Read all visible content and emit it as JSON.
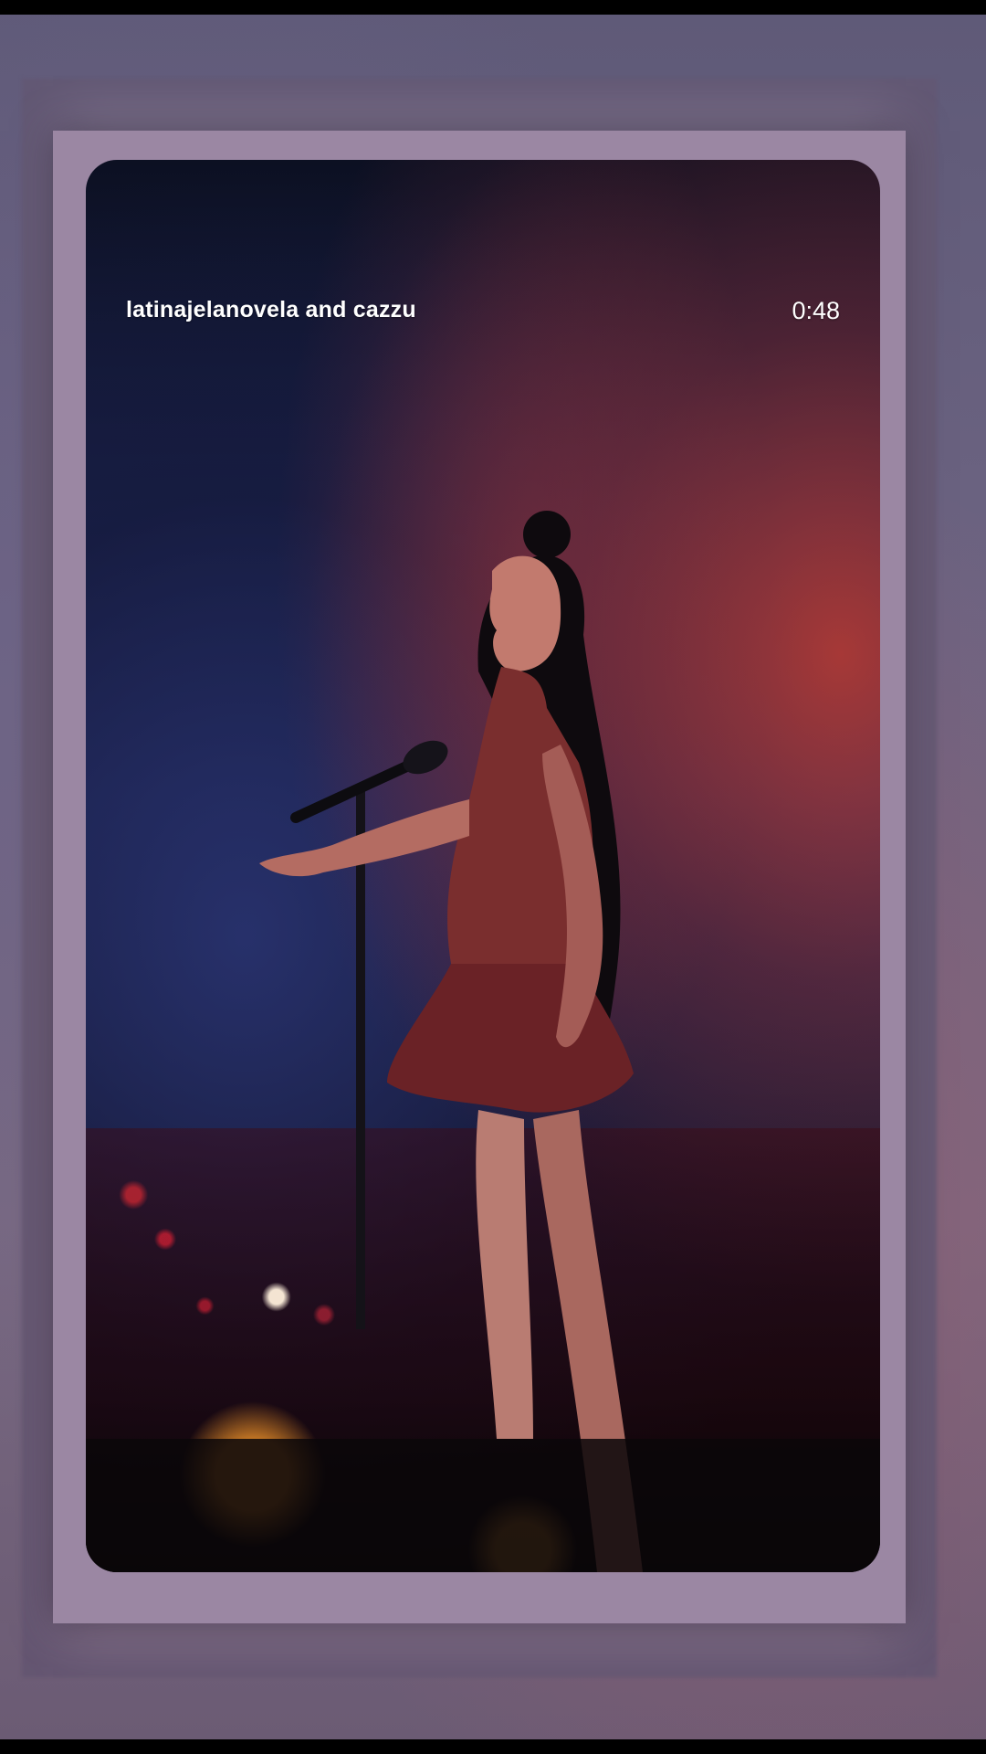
{
  "story": {
    "title": "latinajelanovela and cazzu",
    "time": "0:48"
  }
}
